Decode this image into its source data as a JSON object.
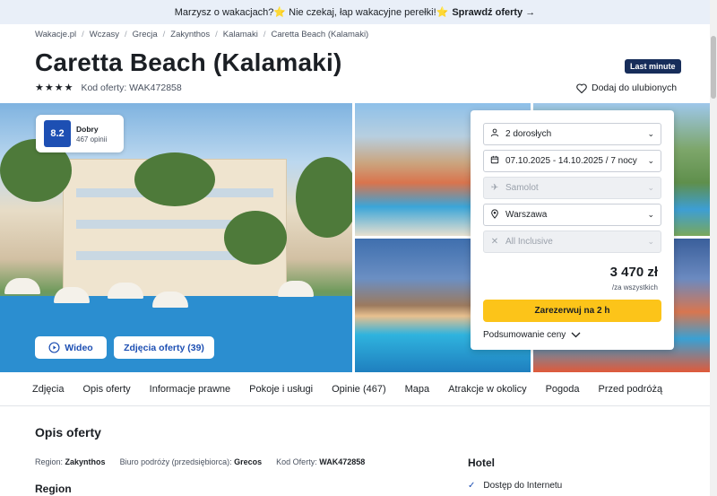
{
  "promo": {
    "text": "Marzysz o wakacjach?⭐ Nie czekaj, łap wakacyjne perełki!⭐",
    "cta": "Sprawdź oferty →"
  },
  "breadcrumb": [
    "Wakacje.pl",
    "Wczasy",
    "Grecja",
    "Zakynthos",
    "Kalamaki",
    "Caretta Beach (Kalamaki)"
  ],
  "offer": {
    "title": "Caretta Beach (Kalamaki)",
    "badge": "Last minute",
    "stars": "★★★★",
    "code_label": "Kod oferty: WAK472858",
    "favorite_label": "Dodaj do ulubionych"
  },
  "review": {
    "score": "8.2",
    "label": "Dobry",
    "count": "467 opinii"
  },
  "gallery": {
    "video_label": "Wideo",
    "photos_label": "Zdjęcia oferty (39)"
  },
  "booking": {
    "guests": "2 dorosłych",
    "dates": "07.10.2025 - 14.10.2025 / 7 nocy",
    "transport": "Samolot",
    "departure": "Warszawa",
    "board": "All Inclusive",
    "price": "3 470 zł",
    "price_note": "/za wszystkich",
    "book_label": "Zarezerwuj na 2 h",
    "summary_label": "Podsumowanie ceny"
  },
  "tabs": [
    "Zdjęcia",
    "Opis oferty",
    "Informacje prawne",
    "Pokoje i usługi",
    "Opinie (467)",
    "Mapa",
    "Atrakcje w okolicy",
    "Pogoda",
    "Przed podróżą"
  ],
  "description": {
    "title": "Opis oferty",
    "region_label": "Region:",
    "region_value": "Zakynthos",
    "operator_label": "Biuro podróży (przedsiębiorca):",
    "operator_value": "Grecos",
    "code_label": "Kod Oferty:",
    "code_value": "WAK472858",
    "region_heading": "Region",
    "hotel_heading": "Hotel",
    "amenity_1": "Dostęp do Internetu"
  },
  "colors": {
    "brand_blue": "#1d4fb3",
    "cta_yellow": "#fcc419",
    "badge_navy": "#172d5a",
    "promo_bg": "#e9eff8"
  }
}
